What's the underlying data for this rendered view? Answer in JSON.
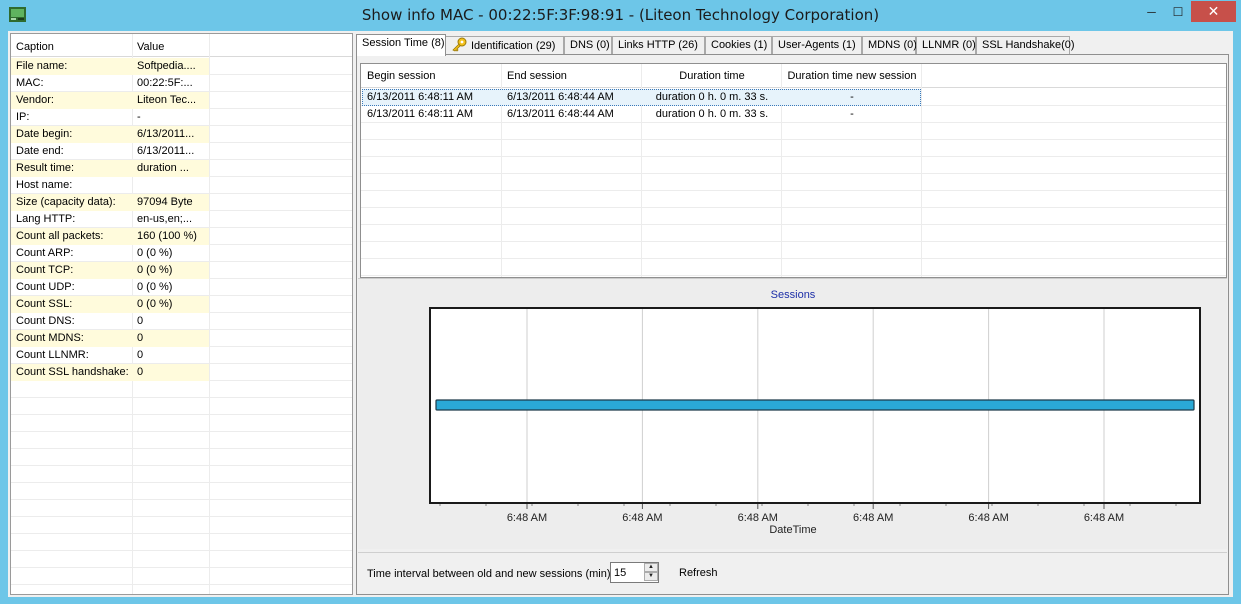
{
  "window": {
    "title": "Show info MAC  -  00:22:5F:3F:98:91 - (Liteon Technology Corporation)",
    "minimize_glyph": "─",
    "maximize_glyph": "☐",
    "close_glyph": "✕"
  },
  "info_grid": {
    "columns": [
      "Caption",
      "Value"
    ],
    "rows": [
      {
        "caption": "File name:",
        "value": "Softpedia...."
      },
      {
        "caption": "MAC:",
        "value": "00:22:5F:..."
      },
      {
        "caption": "Vendor:",
        "value": "Liteon Tec..."
      },
      {
        "caption": "IP:",
        "value": "-"
      },
      {
        "caption": "Date begin:",
        "value": "6/13/2011..."
      },
      {
        "caption": "Date end:",
        "value": "6/13/2011..."
      },
      {
        "caption": "Result time:",
        "value": " duration ..."
      },
      {
        "caption": "Host name:",
        "value": ""
      },
      {
        "caption": "Size (capacity data):",
        "value": "97094 Byte"
      },
      {
        "caption": "Lang HTTP:",
        "value": "en-us,en;..."
      },
      {
        "caption": "Count all packets:",
        "value": "160 (100 %)"
      },
      {
        "caption": "Count ARP:",
        "value": "0 (0 %)"
      },
      {
        "caption": "Count TCP:",
        "value": "0 (0 %)"
      },
      {
        "caption": "Count UDP:",
        "value": "0 (0 %)"
      },
      {
        "caption": "Count SSL:",
        "value": "0 (0 %)"
      },
      {
        "caption": "Count DNS:",
        "value": "0"
      },
      {
        "caption": "Count MDNS:",
        "value": "0"
      },
      {
        "caption": "Count LLNMR:",
        "value": "0"
      },
      {
        "caption": "Count SSL handshake:",
        "value": "0"
      }
    ]
  },
  "tabs": [
    "Session Time (8)",
    "Identification (29)",
    "DNS (0)",
    "Links HTTP (26)",
    "Cookies (1)",
    "User-Agents (1)",
    "MDNS (0)",
    "LLNMR (0)",
    "SSL Handshake(0)"
  ],
  "session_table": {
    "columns": [
      "Begin session",
      "End session",
      "Duration time",
      "Duration time new session"
    ],
    "rows": [
      [
        "6/13/2011 6:48:11 AM",
        "6/13/2011 6:48:44 AM",
        "duration 0 h. 0 m. 33 s.",
        "-"
      ],
      [
        "6/13/2011 6:48:11 AM",
        "6/13/2011 6:48:44 AM",
        "duration 0 h. 0 m. 33 s.",
        "-"
      ]
    ]
  },
  "chart_data": {
    "type": "bar",
    "orientation": "horizontal",
    "title": "Sessions",
    "xlabel": "DateTime",
    "ylabel": "",
    "x_tick_labels": [
      "6:48 AM",
      "6:48 AM",
      "6:48 AM",
      "6:48 AM",
      "6:48 AM",
      "6:48 AM"
    ],
    "grid": "vertical",
    "series": [
      {
        "start": "6/13/2011 6:48:11 AM",
        "end": "6/13/2011 6:48:44 AM",
        "color": "#2aa9d6"
      }
    ]
  },
  "bottom": {
    "interval_label": "Time interval between old and new sessions (min):",
    "interval_value": "15",
    "refresh_label": "Refresh"
  },
  "colors": {
    "frame": "#6dc6e8",
    "row_highlight": "#fffbdc",
    "session_bar": "#2aa9d6",
    "close_button": "#c7504a"
  }
}
